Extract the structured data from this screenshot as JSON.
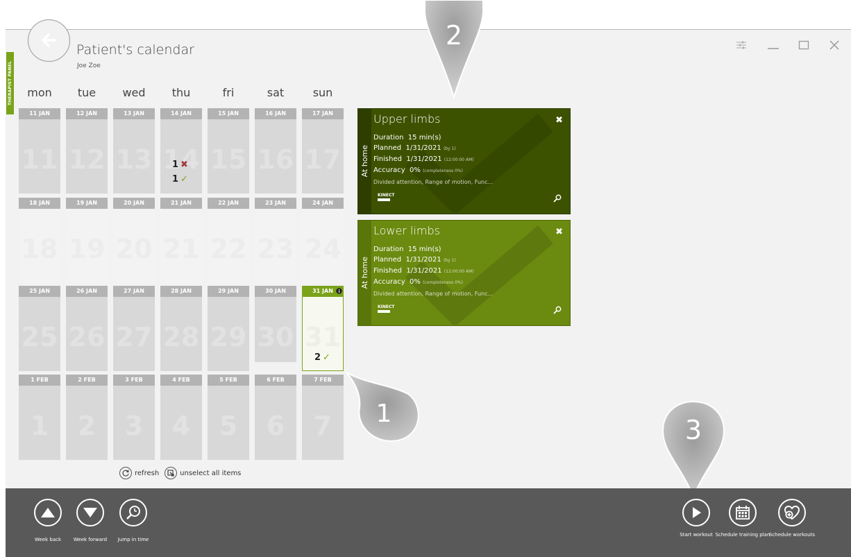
{
  "app": {
    "title": "Patient's calendar",
    "patient": "Joe Zoe",
    "therapist_panel": "THERAPIST PANEL"
  },
  "weekdays": [
    "mon",
    "tue",
    "wed",
    "thu",
    "fri",
    "sat",
    "sun"
  ],
  "weeks": [
    {
      "dates": [
        "11 JAN",
        "12 JAN",
        "13 JAN",
        "14 JAN",
        "15 JAN",
        "16 JAN",
        "17 JAN"
      ],
      "days": [
        "11",
        "12",
        "13",
        "14",
        "15",
        "16",
        "17"
      ]
    },
    {
      "dates": [
        "18 JAN",
        "19 JAN",
        "20 JAN",
        "21 JAN",
        "22 JAN",
        "23 JAN",
        "24 JAN"
      ],
      "days": [
        "18",
        "19",
        "20",
        "21",
        "22",
        "23",
        "24"
      ]
    },
    {
      "dates": [
        "25 JAN",
        "26 JAN",
        "27 JAN",
        "28 JAN",
        "29 JAN",
        "30 JAN",
        "31 JAN"
      ],
      "days": [
        "25",
        "26",
        "27",
        "28",
        "29",
        "30",
        "31"
      ]
    },
    {
      "dates": [
        "1 FEB",
        "2 FEB",
        "3 FEB",
        "4 FEB",
        "5 FEB",
        "6 FEB",
        "7 FEB"
      ],
      "days": [
        "1",
        "2",
        "3",
        "4",
        "5",
        "6",
        "7"
      ]
    }
  ],
  "marks": {
    "thu_failed_count": "1",
    "thu_done_count": "1",
    "sun31_done_count": "2",
    "failed_symbol": "✖",
    "done_symbol": "✓"
  },
  "cards": [
    {
      "title": "Upper limbs",
      "location": "At home",
      "duration_label": "Duration",
      "duration": "15 min(s)",
      "planned_label": "Planned",
      "planned": "1/31/2021",
      "planned_note": "(by 1)",
      "finished_label": "Finished",
      "finished": "1/31/2021",
      "finished_note": "(12:00:00 AM)",
      "accuracy_label": "Accuracy",
      "accuracy": "0%",
      "accuracy_note": "(completeness 0%)",
      "tags": "Divided attention, Range of motion, Func...",
      "device": "KINECT",
      "color": "#3d5200"
    },
    {
      "title": "Lower limbs",
      "location": "At home",
      "duration_label": "Duration",
      "duration": "15 min(s)",
      "planned_label": "Planned",
      "planned": "1/31/2021",
      "planned_note": "(by 1)",
      "finished_label": "Finished",
      "finished": "1/31/2021",
      "finished_note": "(12:00:00 AM)",
      "accuracy_label": "Accuracy",
      "accuracy": "0%",
      "accuracy_note": "(completeness 0%)",
      "tags": "Divided attention, Range of motion, Func...",
      "device": "KINECT",
      "color": "#6b8a10"
    }
  ],
  "links": {
    "refresh": "refresh",
    "unselect": "unselect all items"
  },
  "toolbar": {
    "week_back": "Week back",
    "week_forward": "Week forward",
    "jump": "Jump in time",
    "start_workout": "Start workout",
    "schedule_plan": "Schedule training plan",
    "schedule_workouts": "Schedule workouts"
  },
  "callouts": [
    "1",
    "2",
    "3"
  ],
  "colors": {
    "accent": "#7aa31a",
    "card_dark": "#3d5200",
    "card_light": "#6b8a10",
    "toolbar": "#595959",
    "failed": "#a33a3a",
    "done": "#7aa31a"
  }
}
